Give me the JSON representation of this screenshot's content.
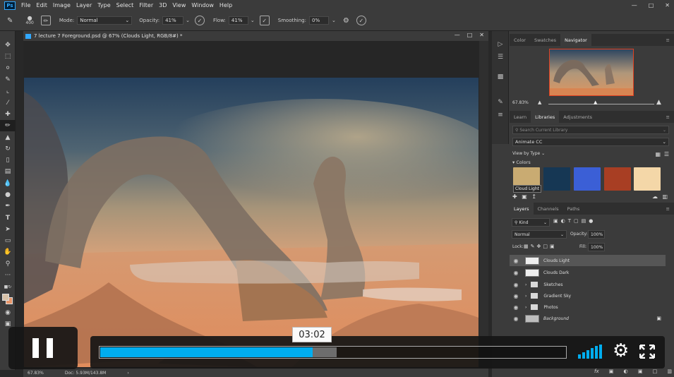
{
  "menubar": {
    "logo": "Ps",
    "items": [
      "File",
      "Edit",
      "Image",
      "Layer",
      "Type",
      "Select",
      "Filter",
      "3D",
      "View",
      "Window",
      "Help"
    ]
  },
  "options": {
    "brush_size": "400",
    "mode_label": "Mode:",
    "mode_value": "Normal",
    "opacity_label": "Opacity:",
    "opacity_value": "41%",
    "flow_label": "Flow:",
    "flow_value": "41%",
    "smoothing_label": "Smoothing:",
    "smoothing_value": "0%"
  },
  "document": {
    "tab_title": "7 lecture 7 Foreground.psd @ 67% (Clouds Light, RGB/8#) *",
    "status_zoom": "67.83%",
    "status_doc": "Doc: 5.93M/143.8M"
  },
  "panels": {
    "top_tabs": [
      "Color",
      "Swatches",
      "Navigator"
    ],
    "navigator_zoom": "67.83%",
    "mid_tabs": [
      "Learn",
      "Libraries",
      "Adjustments"
    ],
    "library_search_placeholder": "Search Current Library",
    "library_name": "Animate CC",
    "view_by": "View by Type",
    "colors_section": "Colors",
    "swatch_tooltip": "Cloud Light",
    "swatch_colors": [
      "#c9ab72",
      "#163754",
      "#3b5fd6",
      "#a83e23",
      "#f4d7a8"
    ],
    "layer_tabs": [
      "Layers",
      "Channels",
      "Paths"
    ],
    "kind_filter": "Kind",
    "blend_mode": "Normal",
    "opacity_label": "Opacity:",
    "opacity_value": "100%",
    "lock_label": "Lock:",
    "fill_label": "Fill:",
    "fill_value": "100%",
    "layers": [
      {
        "name": "Clouds Light",
        "type": "layer"
      },
      {
        "name": "Clouds Dark",
        "type": "layer"
      },
      {
        "name": "Sketches",
        "type": "group"
      },
      {
        "name": "Gradient Sky",
        "type": "group"
      },
      {
        "name": "Photos",
        "type": "group"
      },
      {
        "name": "Background",
        "type": "layer"
      }
    ]
  },
  "video": {
    "time": "03:02",
    "played_fraction": 0.456,
    "buffered_fraction": 0.508,
    "accent": "#00adef"
  }
}
